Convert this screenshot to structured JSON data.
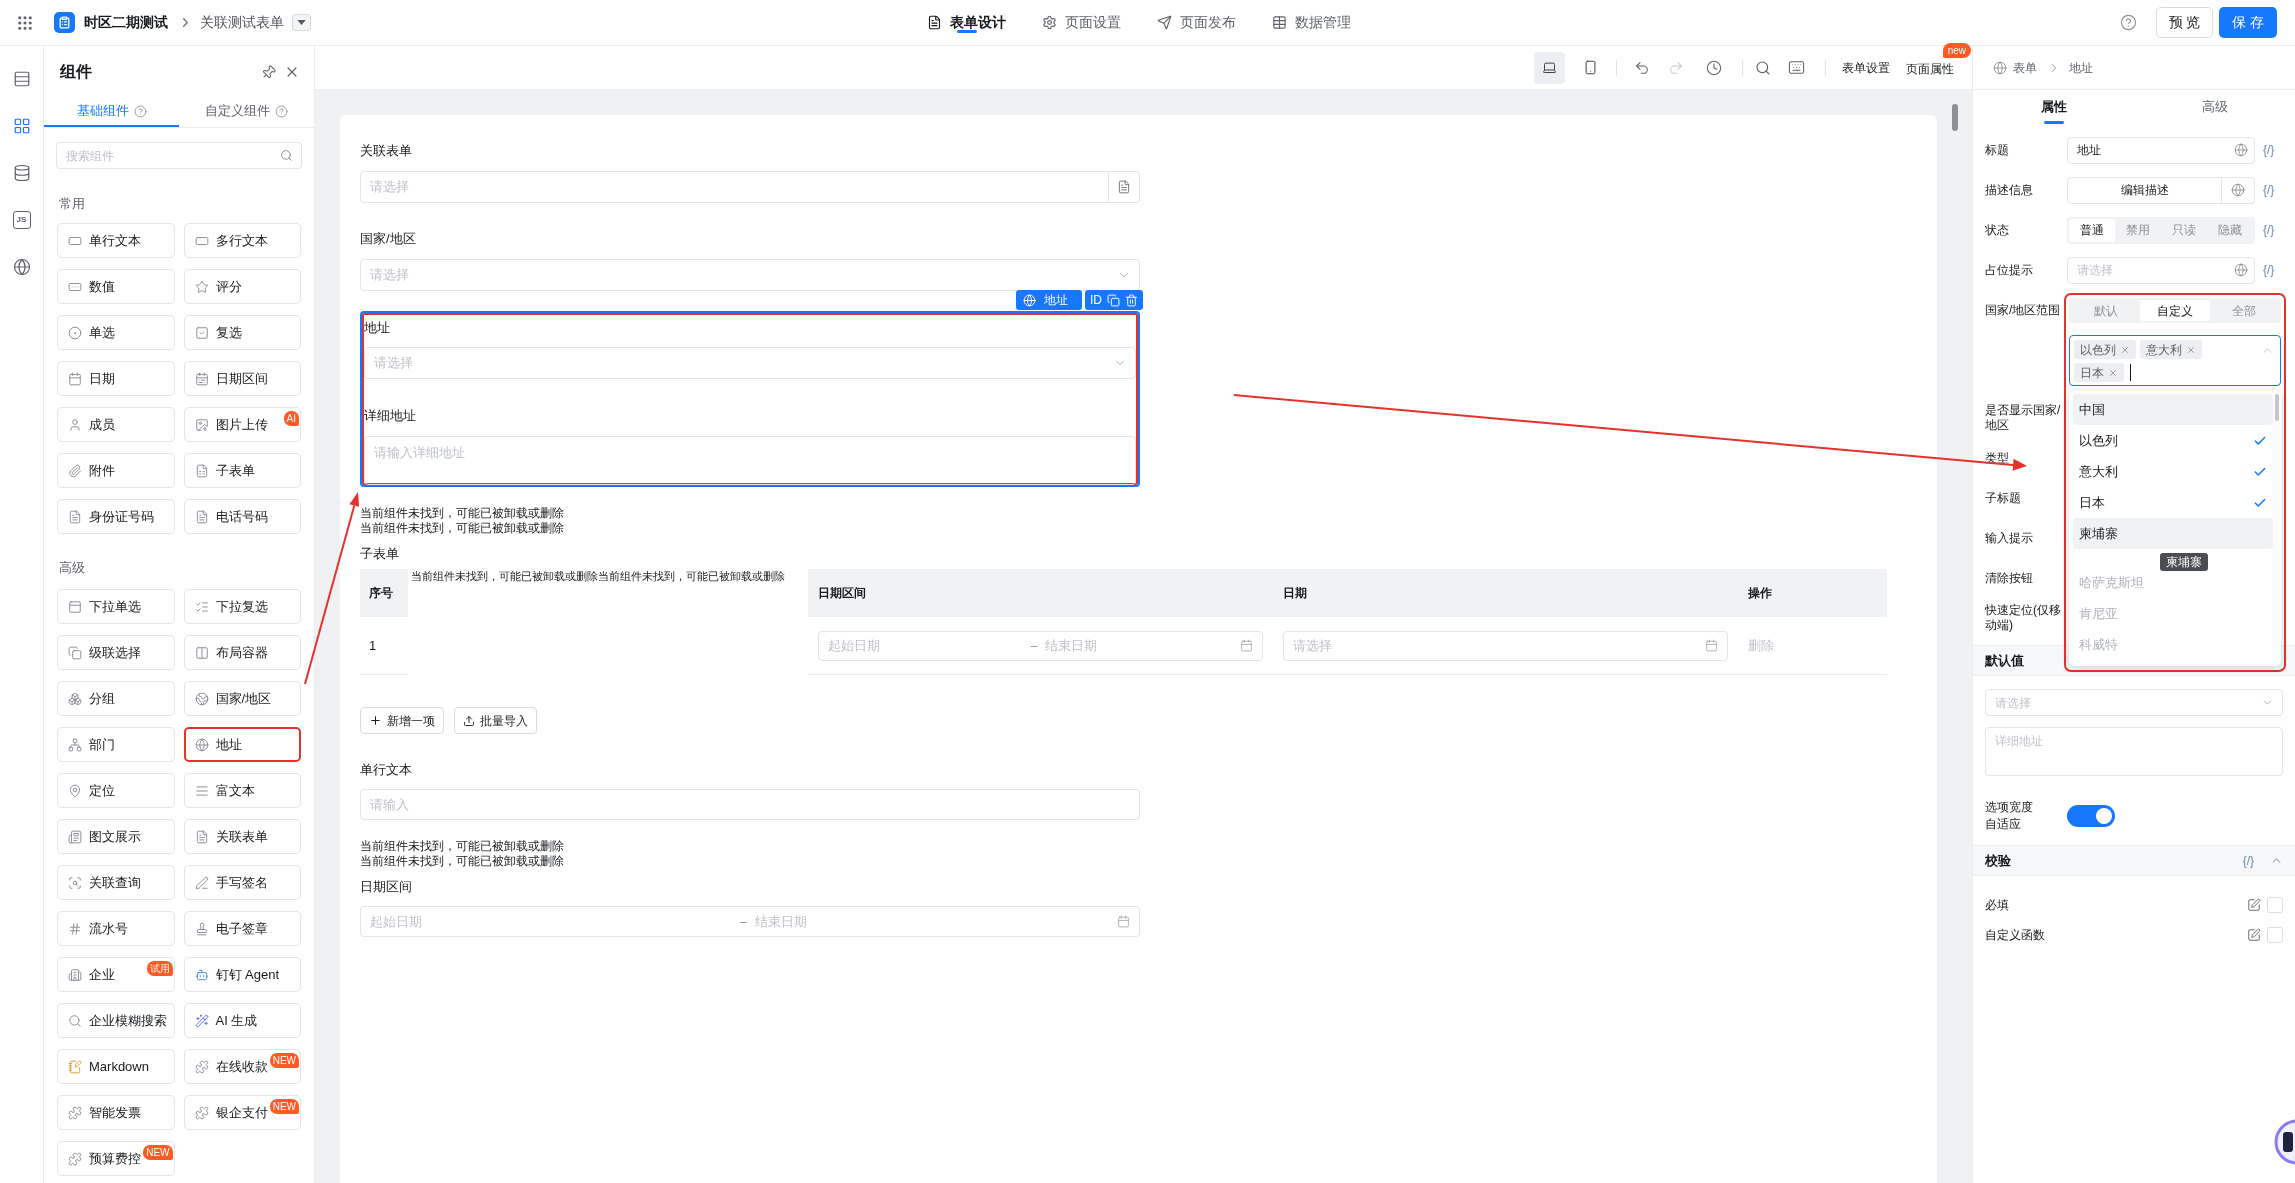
{
  "topbar": {
    "app_name": "时区二期测试",
    "page_name": "关联测试表单",
    "tabs": [
      {
        "kind": "design",
        "label": "表单设计",
        "selected": true
      },
      {
        "kind": "settings",
        "label": "页面设置",
        "selected": false
      },
      {
        "kind": "publish",
        "label": "页面发布",
        "selected": false
      },
      {
        "kind": "data",
        "label": "数据管理",
        "selected": false
      }
    ],
    "preview": "预 览",
    "save": "保 存"
  },
  "rail": [
    {
      "kind": "outline",
      "selected": false
    },
    {
      "kind": "components",
      "selected": true
    },
    {
      "kind": "datasource",
      "selected": false
    },
    {
      "kind": "script",
      "label": "JS",
      "selected": false
    },
    {
      "kind": "i18n",
      "selected": false
    }
  ],
  "component_panel": {
    "title": "组件",
    "tabs": [
      {
        "label": "基础组件",
        "selected": true
      },
      {
        "label": "自定义组件",
        "selected": false
      }
    ],
    "search_placeholder": "搜索组件",
    "groups": [
      {
        "title": "常用",
        "items": [
          {
            "label": "单行文本",
            "highlighted": false
          },
          {
            "label": "多行文本",
            "highlighted": false
          },
          {
            "label": "数值",
            "highlighted": false
          },
          {
            "label": "评分",
            "highlighted": false
          },
          {
            "label": "单选",
            "highlighted": false
          },
          {
            "label": "复选",
            "highlighted": false
          },
          {
            "label": "日期",
            "highlighted": false
          },
          {
            "label": "日期区间",
            "highlighted": false
          },
          {
            "label": "成员",
            "highlighted": false
          },
          {
            "label": "图片上传",
            "badge": "AI",
            "highlighted": false
          },
          {
            "label": "附件",
            "highlighted": false
          },
          {
            "label": "子表单",
            "highlighted": false
          },
          {
            "label": "身份证号码",
            "highlighted": false
          },
          {
            "label": "电话号码",
            "highlighted": false
          }
        ]
      },
      {
        "title": "高级",
        "items": [
          {
            "label": "下拉单选",
            "highlighted": false
          },
          {
            "label": "下拉复选",
            "highlighted": false
          },
          {
            "label": "级联选择",
            "highlighted": false
          },
          {
            "label": "布局容器",
            "highlighted": false
          },
          {
            "label": "分组",
            "highlighted": false
          },
          {
            "label": "国家/地区",
            "highlighted": false
          },
          {
            "label": "部门",
            "highlighted": false
          },
          {
            "label": "地址",
            "highlighted": true
          },
          {
            "label": "定位",
            "highlighted": false
          },
          {
            "label": "富文本",
            "highlighted": false
          },
          {
            "label": "图文展示",
            "highlighted": false
          },
          {
            "label": "关联表单",
            "highlighted": false
          },
          {
            "label": "关联查询",
            "highlighted": false
          },
          {
            "label": "手写签名",
            "highlighted": false
          },
          {
            "label": "流水号",
            "highlighted": false
          },
          {
            "label": "电子签章",
            "highlighted": false
          },
          {
            "label": "企业",
            "badge": "试用",
            "highlighted": false
          },
          {
            "label": "钉钉 Agent",
            "highlighted": false
          },
          {
            "label": "企业模糊搜索",
            "highlighted": false
          },
          {
            "label": "AI 生成",
            "highlighted": false
          },
          {
            "label": "Markdown",
            "highlighted": false
          },
          {
            "label": "在线收款",
            "badge": "NEW",
            "highlighted": false
          },
          {
            "label": "智能发票",
            "highlighted": false
          },
          {
            "label": "银企支付",
            "badge": "NEW",
            "highlighted": false
          },
          {
            "label": "预算费控",
            "badge": "NEW",
            "highlighted": false
          }
        ]
      }
    ]
  },
  "canvas_toolbar": {
    "devices": [
      {
        "kind": "desktop",
        "selected": true
      },
      {
        "kind": "mobile",
        "selected": false
      }
    ],
    "undo_disabled": false,
    "redo_disabled": true,
    "form_settings": "表单设置",
    "page_properties": "页面属性",
    "page_properties_badge": "new"
  },
  "form": {
    "fields": [
      {
        "kind": "lookup",
        "label": "关联表单",
        "placeholder": "请选择"
      },
      {
        "kind": "select",
        "label": "国家/地区",
        "placeholder": "请选择"
      },
      {
        "kind": "address",
        "label": "地址",
        "placeholder": "请选择",
        "detail_label": "详细地址",
        "detail_placeholder": "请输入详细地址",
        "selected": true,
        "highlighted": true,
        "type_tag": "地址",
        "id_button": "ID"
      },
      {
        "kind": "notice",
        "lines": [
          "当前组件未找到，可能已被卸载或删除",
          "当前组件未找到，可能已被卸载或删除"
        ]
      },
      {
        "kind": "subform",
        "label": "子表单",
        "columns": [
          {
            "kind": "index",
            "label": "序号"
          },
          {
            "kind": "notice",
            "label": "当前组件未找到，可能已被卸载或删除当前组件未找到，可能已被卸载或删除"
          },
          {
            "kind": "date_range",
            "label": "日期区间"
          },
          {
            "kind": "date",
            "label": "日期"
          },
          {
            "kind": "actions",
            "label": "操作"
          }
        ],
        "rows": [
          {
            "index": "1",
            "start_placeholder": "起始日期",
            "separator": "–",
            "end_placeholder": "结束日期",
            "date_placeholder": "请选择",
            "action": "删除",
            "action_disabled": true
          }
        ],
        "add_button": "新增一项",
        "import_button": "批量导入"
      },
      {
        "kind": "text",
        "label": "单行文本",
        "placeholder": "请输入"
      },
      {
        "kind": "notice",
        "lines": [
          "当前组件未找到，可能已被卸载或删除",
          "当前组件未找到，可能已被卸载或删除"
        ]
      },
      {
        "kind": "date_range",
        "label": "日期区间",
        "start_placeholder": "起始日期",
        "separator": "–",
        "end_placeholder": "结束日期"
      }
    ]
  },
  "properties": {
    "breadcrumb": [
      "表单",
      "地址"
    ],
    "tabs": [
      {
        "label": "属性",
        "selected": true
      },
      {
        "label": "高级",
        "selected": false
      }
    ],
    "rows": [
      {
        "kind": "text",
        "label": "标题",
        "value": "地址",
        "binding": "{/}"
      },
      {
        "kind": "button",
        "label": "描述信息",
        "value": "编辑描述",
        "binding": "{/}"
      },
      {
        "kind": "segmented",
        "label": "状态",
        "options": [
          {
            "label": "普通",
            "selected": true
          },
          {
            "label": "禁用",
            "selected": false
          },
          {
            "label": "只读",
            "selected": false
          },
          {
            "label": "隐藏",
            "selected": false
          }
        ],
        "binding": "{/}"
      },
      {
        "kind": "placeholder",
        "label": "占位提示",
        "placeholder": "请选择",
        "binding": "{/}"
      }
    ],
    "region_scope": {
      "label": "国家/地区范围",
      "highlighted": true,
      "modes": [
        {
          "label": "默认",
          "selected": false
        },
        {
          "label": "自定义",
          "selected": true
        },
        {
          "label": "全部",
          "selected": false
        }
      ],
      "tags": [
        "以色列",
        "意大利",
        "日本"
      ],
      "options": [
        {
          "label": "中国",
          "checked": false,
          "active": true,
          "disabled": false
        },
        {
          "label": "以色列",
          "checked": true,
          "active": false,
          "disabled": false
        },
        {
          "label": "意大利",
          "checked": true,
          "active": false,
          "disabled": false
        },
        {
          "label": "日本",
          "checked": true,
          "active": false,
          "disabled": false
        },
        {
          "label": "柬埔寨",
          "checked": false,
          "active": true,
          "disabled": false,
          "tooltip": "柬埔寨"
        },
        {
          "label": "哈萨克斯坦",
          "checked": false,
          "active": false,
          "disabled": true
        },
        {
          "label": "肯尼亚",
          "checked": false,
          "active": false,
          "disabled": true
        },
        {
          "label": "科威特",
          "checked": false,
          "active": false,
          "disabled": true
        }
      ]
    },
    "covered_labels": [
      "是否显示国家/地区",
      "类型",
      "子标题",
      "输入提示",
      "清除按钮",
      "快速定位(仅移动端)"
    ],
    "default_value": {
      "title": "默认值",
      "select_placeholder": "请选择",
      "detail_placeholder": "详细地址"
    },
    "adaptive_width": {
      "label": "选项宽度自适应",
      "on": true
    },
    "validation": {
      "title": "校验",
      "binding": "{/}",
      "expanded": true,
      "rules": [
        {
          "label": "必填",
          "checked": false
        },
        {
          "label": "自定义函数",
          "checked": false
        }
      ]
    }
  }
}
